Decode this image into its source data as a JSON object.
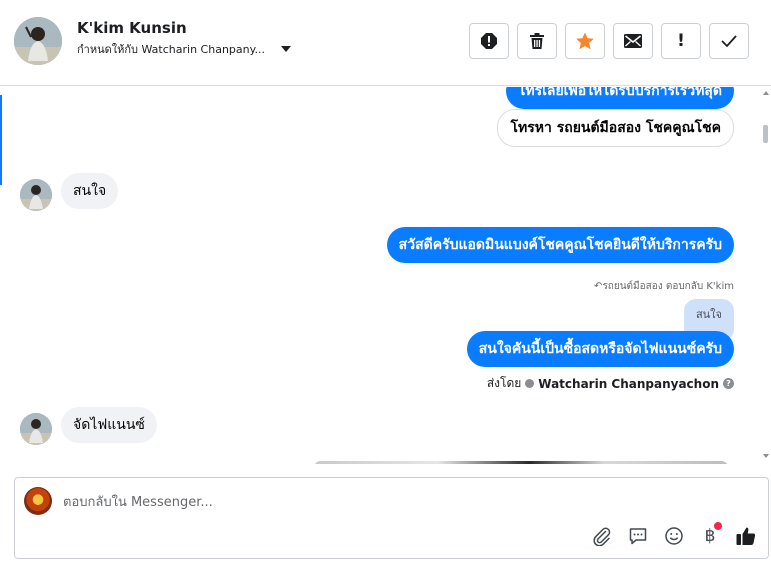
{
  "header": {
    "contact_name": "K'kim Kunsin",
    "assign_label": "กำหนดให้กับ Watcharin Chanpany..."
  },
  "toolbar": {
    "icons": [
      "spam-icon",
      "trash-icon",
      "star-icon",
      "mail-icon",
      "exclamation-icon",
      "check-icon"
    ],
    "exclamation_glyph": "!",
    "star_color": "#f7852a"
  },
  "messages": {
    "partial_top": "โทรเลยเพื่อให้ได้รับบริการเร็วที่สุด",
    "call_button": "โทรหา รถยนต์มือสอง โชคคูณโชค",
    "in_1": "สนใจ",
    "out_1": "สวัสดีครับแอดมินแบงค์โชคคูณโชคยินดีให้บริการครับ",
    "reply_meta": "รถยนต์มือสอง ตอบกลับ K'kim",
    "quoted": "สนใจ",
    "out_2": "สนใจคันนี้เป็นซื้อสดหรือจัดไฟแนนซ์ครับ",
    "sent_by_label": "ส่งโดย",
    "sent_by_agent": "Watcharin Chanpanyachon",
    "help_glyph": "?",
    "in_2": "จัดไฟแนนซ์"
  },
  "composer": {
    "placeholder": "ตอบกลับใน Messenger...",
    "baht_glyph": "฿",
    "icons": [
      "attachment-icon",
      "saved-reply-icon",
      "emoji-icon",
      "payment-icon",
      "like-icon"
    ]
  },
  "colors": {
    "outgoing_bubble": "#0a7cff",
    "incoming_bubble": "#f0f2f5",
    "quote_bubble": "#cfe0fb",
    "notification_dot": "#f02849"
  }
}
